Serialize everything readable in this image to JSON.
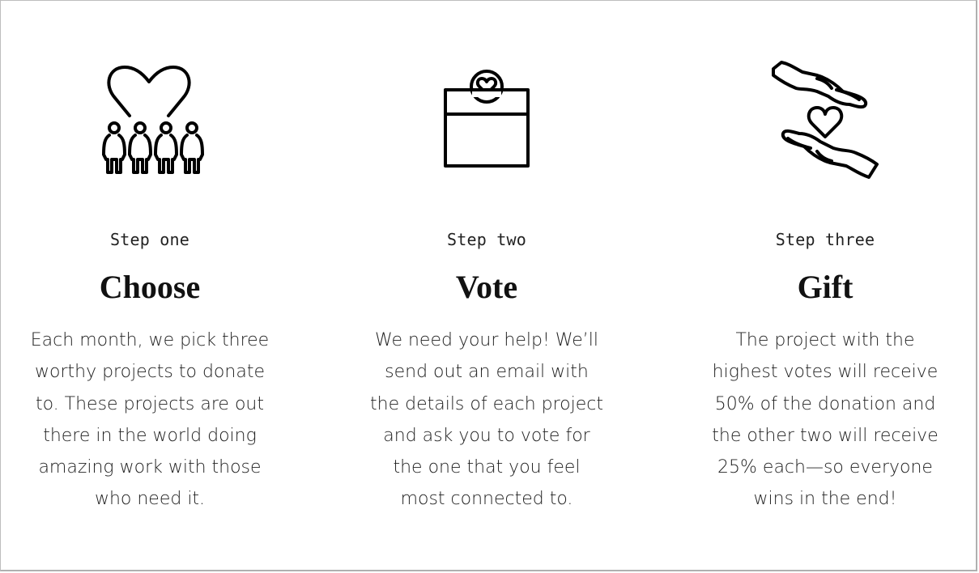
{
  "steps": [
    {
      "label": "Step one",
      "title": "Choose",
      "description": "Each month, we pick three worthy projects to donate to. These projects are out there in the world doing amazing work with those who need it.",
      "icon": "heart-people-icon"
    },
    {
      "label": "Step two",
      "title": "Vote",
      "description": "We need your help! We’ll send out an email with the details of each project and ask you to vote for the one that you feel most connected to.",
      "icon": "ballot-box-heart-icon"
    },
    {
      "label": "Step three",
      "title": "Gift",
      "description": "The project with the highest votes will receive 50% of the donation and the other two will receive 25% each—so everyone wins in the end!",
      "icon": "hands-heart-icon"
    }
  ],
  "colors": {
    "text": "#111111",
    "background": "#ffffff",
    "border": "#bdbdbd"
  }
}
